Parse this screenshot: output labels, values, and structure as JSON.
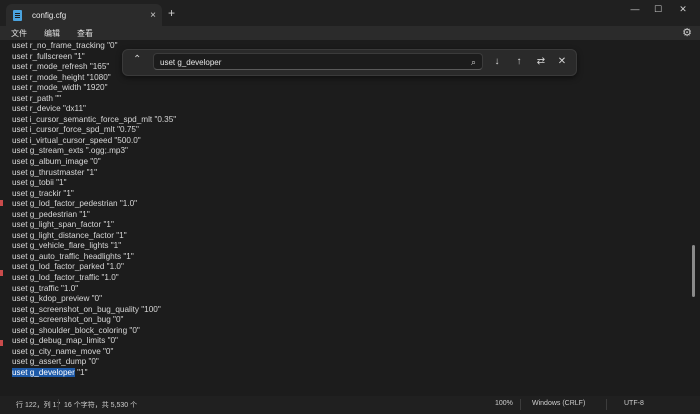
{
  "window": {
    "tab_title": "config.cfg",
    "tab_close": "×",
    "new_tab": "+",
    "minimize": "—",
    "maximize": "☐",
    "close": "✕"
  },
  "menu": [
    "文件",
    "编辑",
    "查看"
  ],
  "settings_icon": "⚙",
  "find": {
    "query": "uset g_developer",
    "search_icon": "⌕",
    "collapse_icon": "⌃",
    "next_icon": "↓",
    "prev_icon": "↑",
    "replace_icon": "⇄",
    "close_icon": "✕"
  },
  "editor": {
    "lines": [
      "uset r_no_frame_tracking \"0\"",
      "uset r_fullscreen \"1\"",
      "uset r_mode_refresh \"165\"",
      "uset r_mode_height \"1080\"",
      "uset r_mode_width \"1920\"",
      "uset r_path \"\"",
      "uset r_device \"dx11\"",
      "uset i_cursor_semantic_force_spd_mlt \"0.35\"",
      "uset i_cursor_force_spd_mlt \"0.75\"",
      "uset i_virtual_cursor_speed \"500.0\"",
      "uset g_stream_exts \".ogg;.mp3\"",
      "uset g_album_image \"0\"",
      "uset g_thrustmaster \"1\"",
      "uset g_tobii \"1\"",
      "uset g_trackir \"1\"",
      "uset g_lod_factor_pedestrian \"1.0\"",
      "uset g_pedestrian \"1\"",
      "uset g_light_span_factor \"1\"",
      "uset g_light_distance_factor \"1\"",
      "uset g_vehicle_flare_lights \"1\"",
      "uset g_auto_traffic_headlights \"1\"",
      "uset g_lod_factor_parked \"1.0\"",
      "uset g_lod_factor_traffic \"1.0\"",
      "uset g_traffic \"1.0\"",
      "uset g_kdop_preview \"0\"",
      "uset g_screenshot_on_bug_quality \"100\"",
      "uset g_screenshot_on_bug \"0\"",
      "uset g_shoulder_block_coloring \"0\"",
      "uset g_debug_map_limits \"0\"",
      "uset g_city_name_move \"0\"",
      "uset g_assert_dump \"0\""
    ],
    "last_line_highlight": "uset g_developer",
    "last_line_rest": " \"1\""
  },
  "status": {
    "position": "行 122，列 17",
    "selection": "16 个字符，共 5,530 个",
    "zoom": "100%",
    "line_ending": "Windows (CRLF)",
    "encoding": "UTF-8"
  },
  "colors": {
    "background": "#1c1c1c",
    "selection": "#1e5aa8"
  }
}
